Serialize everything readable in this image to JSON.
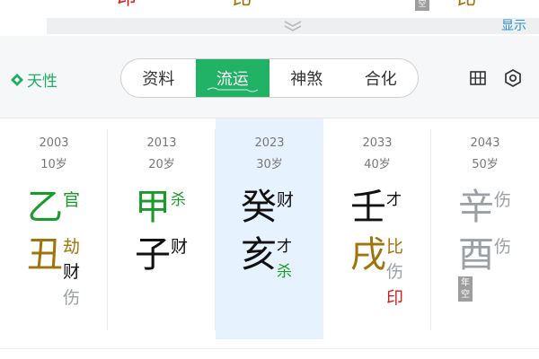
{
  "top": {
    "chars": [
      {
        "text": "印",
        "color": "#d81e1e"
      },
      {
        "text": "比",
        "color": "#a0740a"
      },
      {
        "text": "比",
        "color": "#a0740a"
      }
    ],
    "badge": "空",
    "show_label": "显示",
    "expand_icon": "double-chevron-down-icon"
  },
  "toolbar": {
    "brand": "天性",
    "brand_icon": "diamond-icon",
    "tabs": [
      "资料",
      "流运",
      "神煞",
      "合化"
    ],
    "active_tab": 1,
    "grid_icon": "grid-icon",
    "gear_icon": "hexagon-settings-icon"
  },
  "colors": {
    "green": "#1a9a2a",
    "gold": "#a0740a",
    "red": "#d81e1e",
    "gray": "#9aa0a6",
    "black": "#111111",
    "accent": "#22b265"
  },
  "columns": [
    {
      "year": "2003",
      "age": "10岁",
      "stem": "乙",
      "stem_tag": "官",
      "branch": "丑",
      "branch_tags": [
        "劫",
        "财",
        "伤"
      ]
    },
    {
      "year": "2013",
      "age": "20岁",
      "stem": "甲",
      "stem_tag": "杀",
      "branch": "子",
      "branch_tags": [
        "财"
      ]
    },
    {
      "year": "2023",
      "age": "30岁",
      "stem": "癸",
      "stem_tag": "财",
      "branch": "亥",
      "branch_tags": [
        "才",
        "杀"
      ]
    },
    {
      "year": "2033",
      "age": "40岁",
      "stem": "壬",
      "stem_tag": "才",
      "branch": "戌",
      "branch_tags": [
        "比",
        "伤",
        "印"
      ]
    },
    {
      "year": "2043",
      "age": "50岁",
      "stem": "辛",
      "stem_tag": "伤",
      "branch": "酉",
      "branch_tags": [
        "伤"
      ],
      "empty_badge": "年空"
    }
  ]
}
